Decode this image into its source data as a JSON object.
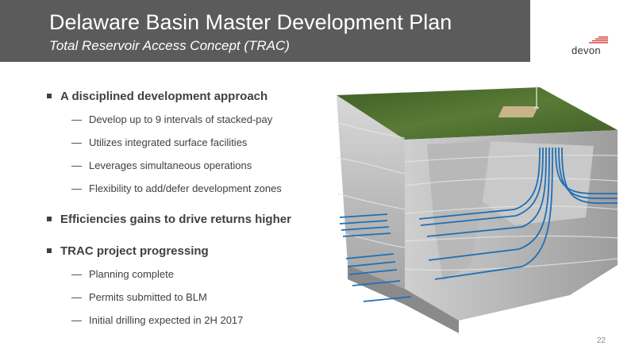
{
  "slide": {
    "title": "Delaware Basin Master Development Plan",
    "subtitle": "Total Reservoir Access Concept (TRAC)",
    "logo_text": "devon",
    "page_number": "22"
  },
  "bullets": [
    {
      "text": "A disciplined development approach",
      "subs": [
        "Develop up to 9 intervals of stacked-pay",
        "Utilizes integrated surface facilities",
        "Leverages simultaneous operations",
        "Flexibility to add/defer development zones"
      ]
    },
    {
      "text": "Efficiencies gains to drive returns higher",
      "subs": []
    },
    {
      "text": "TRAC project progressing",
      "subs": [
        "Planning complete",
        "Permits submitted to BLM",
        "Initial drilling expected in 2H 2017"
      ]
    }
  ],
  "dash_glyph": "—",
  "colors": {
    "header_bg": "#5b5b5b",
    "text": "#404040",
    "well_blue": "#1f6fb5",
    "grass": "#4e6b2e",
    "logo_red": "#d0342c"
  }
}
